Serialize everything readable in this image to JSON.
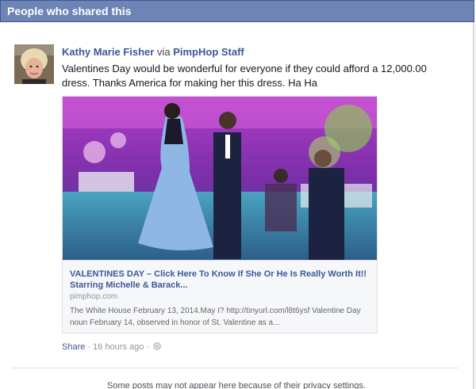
{
  "dialog": {
    "title": "People who shared this"
  },
  "post": {
    "author_name": "Kathy Marie Fisher",
    "via_word": "via",
    "via_page": "PimpHop Staff",
    "message": "Valentines Day would be wonderful for everyone if they could afford a 12,000.00 dress. Thanks America for making her this dress. Ha Ha",
    "attachment": {
      "title": "VALENTINES DAY – Click Here To Know If She Or He Is Really Worth It!! Starring Michelle & Barack...",
      "domain": "pimphop.com",
      "description": "The White House February 13, 2014.May I? http://tinyurl.com/l8t6ysf Valentine Day noun February 14, observed in honor of St. Valentine as a..."
    },
    "footer": {
      "share_label": "Share",
      "separator": "·",
      "time": "16 hours ago",
      "privacy_icon": "globe-icon"
    }
  },
  "notice": "Some posts may not appear here because of their privacy settings.",
  "colors": {
    "header_bg": "#6d84b4",
    "link": "#3b5998"
  }
}
